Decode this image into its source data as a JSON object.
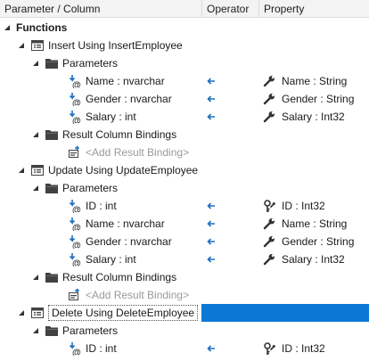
{
  "header": {
    "col1": "Parameter / Column",
    "col2": "Operator",
    "col3": "Property"
  },
  "functions_label": "Functions",
  "add_binding": "<Add Result Binding>",
  "functions": [
    {
      "label": "Insert Using InsertEmployee",
      "parameters_label": "Parameters",
      "bindings_label": "Result Column Bindings",
      "params": [
        {
          "name": "Name : nvarchar",
          "property": "Name : String",
          "prop_icon": "wrench-icon"
        },
        {
          "name": "Gender : nvarchar",
          "property": "Gender : String",
          "prop_icon": "wrench-icon"
        },
        {
          "name": "Salary : int",
          "property": "Salary : Int32",
          "prop_icon": "wrench-icon"
        }
      ]
    },
    {
      "label": "Update Using UpdateEmployee",
      "parameters_label": "Parameters",
      "bindings_label": "Result Column Bindings",
      "params": [
        {
          "name": "ID : int",
          "property": "ID : Int32",
          "prop_icon": "key-wrench-icon"
        },
        {
          "name": "Name : nvarchar",
          "property": "Name : String",
          "prop_icon": "wrench-icon"
        },
        {
          "name": "Gender : nvarchar",
          "property": "Gender : String",
          "prop_icon": "wrench-icon"
        },
        {
          "name": "Salary : int",
          "property": "Salary : Int32",
          "prop_icon": "wrench-icon"
        }
      ]
    },
    {
      "label": "Delete Using DeleteEmployee",
      "parameters_label": "Parameters",
      "params": [
        {
          "name": "ID : int",
          "property": "ID : Int32",
          "prop_icon": "key-wrench-icon"
        }
      ]
    }
  ],
  "colors": {
    "selection": "#0a78d4",
    "arrow": "#1f6fc0"
  }
}
